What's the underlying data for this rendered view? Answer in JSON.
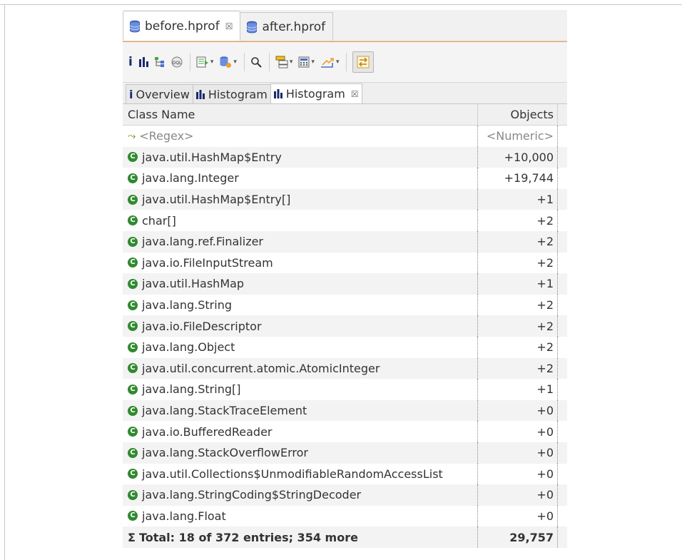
{
  "editor_tabs": [
    {
      "label": "before.hprof",
      "close": "☒",
      "active": true
    },
    {
      "label": "after.hprof",
      "active": false
    }
  ],
  "view_tabs": [
    {
      "icon": "i",
      "label": "Overview"
    },
    {
      "icon": "▐",
      "label": "Histogram"
    },
    {
      "icon": "▐",
      "label": "Histogram",
      "close": "☒",
      "active": true
    }
  ],
  "columns": {
    "name": "Class Name",
    "objects": "Objects"
  },
  "filter": {
    "name": "<Regex>",
    "objects": "<Numeric>"
  },
  "rows": [
    {
      "name": "java.util.HashMap$Entry",
      "objects": "+10,000"
    },
    {
      "name": "java.lang.Integer",
      "objects": "+19,744"
    },
    {
      "name": "java.util.HashMap$Entry[]",
      "objects": "+1"
    },
    {
      "name": "char[]",
      "objects": "+2"
    },
    {
      "name": "java.lang.ref.Finalizer",
      "objects": "+2"
    },
    {
      "name": "java.io.FileInputStream",
      "objects": "+2"
    },
    {
      "name": "java.util.HashMap",
      "objects": "+1"
    },
    {
      "name": "java.lang.String",
      "objects": "+2"
    },
    {
      "name": "java.io.FileDescriptor",
      "objects": "+2"
    },
    {
      "name": "java.lang.Object",
      "objects": "+2"
    },
    {
      "name": "java.util.concurrent.atomic.AtomicInteger",
      "objects": "+2"
    },
    {
      "name": "java.lang.String[]",
      "objects": "+1"
    },
    {
      "name": "java.lang.StackTraceElement",
      "objects": "+0"
    },
    {
      "name": "java.io.BufferedReader",
      "objects": "+0"
    },
    {
      "name": "java.lang.StackOverflowError",
      "objects": "+0"
    },
    {
      "name": "java.util.Collections$UnmodifiableRandomAccessList",
      "objects": "+0"
    },
    {
      "name": "java.lang.StringCoding$StringDecoder",
      "objects": "+0"
    },
    {
      "name": "java.lang.Float",
      "objects": "+0"
    }
  ],
  "total": {
    "label": "Total: 18 of 372 entries; 354 more",
    "objects": "29,757"
  },
  "icons": {
    "class_icon_glyph": "C",
    "sigma_glyph": "Σ",
    "filter_glyph": "⤳",
    "info_glyph": "i",
    "search_glyph": "⚲"
  },
  "colors": {
    "accent": "#ff9b43",
    "class_icon": "#2f8a2f",
    "heap_icon": "#4a6fc9"
  }
}
